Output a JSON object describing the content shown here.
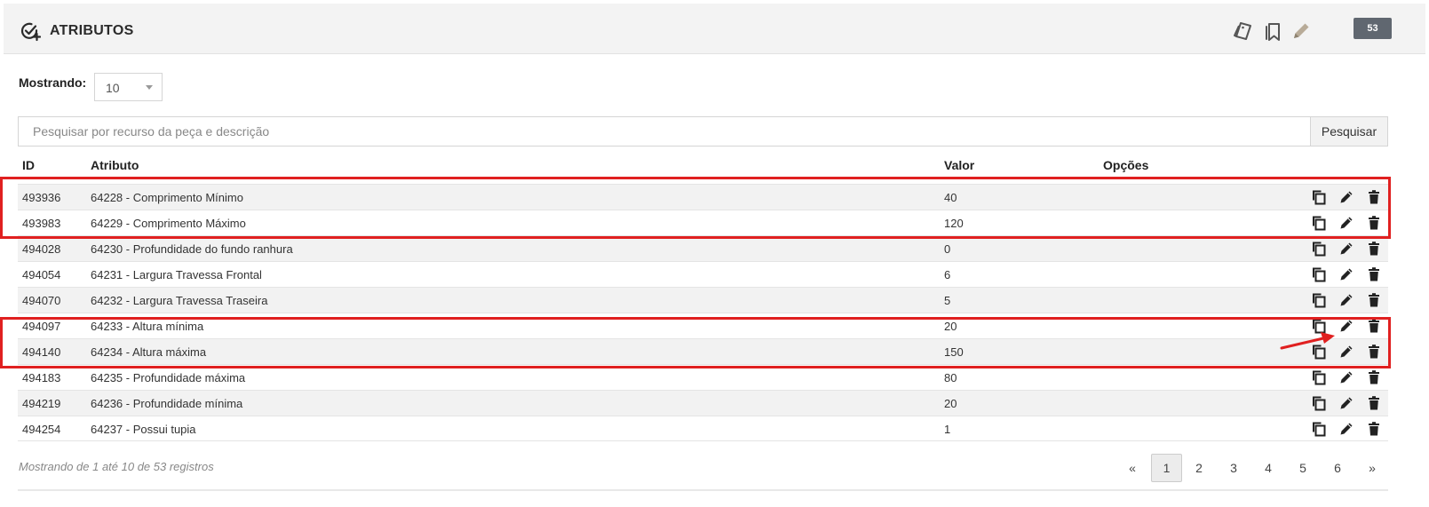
{
  "header": {
    "title": "ATRIBUTOS",
    "count_badge": "53"
  },
  "controls": {
    "show_label": "Mostrando:",
    "show_value": "10",
    "search_placeholder": "Pesquisar por recurso da peça e descrição",
    "search_button": "Pesquisar"
  },
  "table": {
    "columns": [
      "ID",
      "Atributo",
      "Valor",
      "Opções"
    ],
    "rows": [
      {
        "id": "493936",
        "atributo": "64228 - Comprimento Mínimo",
        "valor": "40"
      },
      {
        "id": "493983",
        "atributo": "64229 - Comprimento Máximo",
        "valor": "120"
      },
      {
        "id": "494028",
        "atributo": "64230 - Profundidade do fundo ranhura",
        "valor": "0"
      },
      {
        "id": "494054",
        "atributo": "64231 - Largura Travessa Frontal",
        "valor": "6"
      },
      {
        "id": "494070",
        "atributo": "64232 - Largura Travessa Traseira",
        "valor": "5"
      },
      {
        "id": "494097",
        "atributo": "64233 - Altura mínima",
        "valor": "20"
      },
      {
        "id": "494140",
        "atributo": "64234 - Altura máxima",
        "valor": "150"
      },
      {
        "id": "494183",
        "atributo": "64235 - Profundidade máxima",
        "valor": "80"
      },
      {
        "id": "494219",
        "atributo": "64236 - Profundidade mínima",
        "valor": "20"
      },
      {
        "id": "494254",
        "atributo": "64237 - Possui tupia",
        "valor": "1"
      }
    ]
  },
  "footer": {
    "info": "Mostrando de 1 até 10 de 53 registros",
    "pagination": {
      "prev": "«",
      "pages": [
        "1",
        "2",
        "3",
        "4",
        "5",
        "6"
      ],
      "next": "»",
      "current": "1"
    }
  },
  "colors": {
    "highlight": "#e02020",
    "badge": "#606770",
    "row_stripe": "#f2f2f2"
  }
}
